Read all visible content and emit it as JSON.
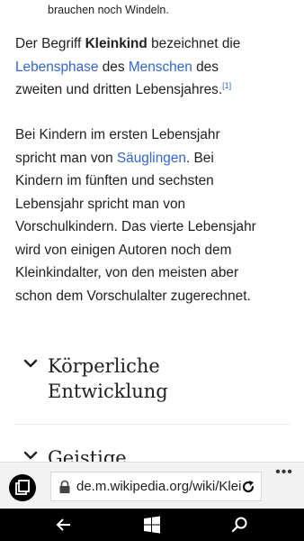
{
  "article": {
    "caption": "brauchen noch Windeln.",
    "para1": {
      "l1_a": "Der Begriff ",
      "l1_bold": "Kleinkind",
      "l1_b": " bezeichnet die",
      "l2_link1": "Lebensphase",
      "l2_a": " des ",
      "l2_link2": "Menschen",
      "l2_b": " des",
      "l3_a": "zweiten und dritten Lebensjahres.",
      "l3_ref": "[1]"
    },
    "para2": {
      "l1": "Bei Kindern im ersten Lebensjahr",
      "l2_a": "spricht man von ",
      "l2_link": "Säuglingen",
      "l2_b": ". Bei",
      "l3": "Kindern im fünften und sechsten",
      "l4": "Lebensjahr spricht man von",
      "l5": "Vorschulkindern. Das vierte Lebensjahr",
      "l6": "wird von einigen Autoren noch dem",
      "l7": "Kleinkindalter, von den meisten aber",
      "l8": "schon dem Vorschulalter zugerechnet."
    },
    "sections": [
      {
        "line1": "Körperliche",
        "line2": "Entwicklung"
      },
      {
        "line1": "Geistige"
      }
    ]
  },
  "browser": {
    "url": "de.m.wikipedia.org/wiki/Kleinkind",
    "more_label": "•••"
  },
  "colors": {
    "link": "#3366cc",
    "text": "#202122",
    "toolbar": "#f2f2f2",
    "navbar": "#000000"
  },
  "icons": [
    "tabs-icon",
    "lock-icon",
    "reload-icon",
    "more-icon",
    "back-arrow-icon",
    "windows-logo-icon",
    "search-icon",
    "chevron-down-icon"
  ]
}
